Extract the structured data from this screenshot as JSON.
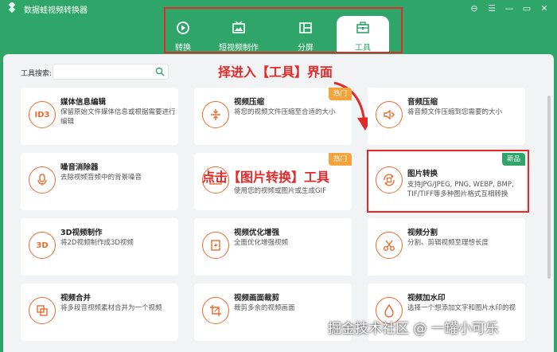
{
  "window": {
    "title": "数据蛙视频转换器",
    "controls": [
      "⊖",
      "☰",
      "—",
      "▭",
      "✕"
    ]
  },
  "tabs": [
    {
      "label": "转换",
      "icon": "convert-icon",
      "active": false
    },
    {
      "label": "短视频制作",
      "icon": "tv-icon",
      "active": false
    },
    {
      "label": "分屏",
      "icon": "split-screen-icon",
      "active": false
    },
    {
      "label": "工具",
      "icon": "toolbox-icon",
      "active": true
    }
  ],
  "search": {
    "label": "工具搜索:",
    "value": "",
    "placeholder": ""
  },
  "annotations": {
    "step1": "择进入【工具】界面",
    "step2": "点击【图片转换】工具"
  },
  "cards": [
    {
      "title": "媒体信息编辑",
      "desc": "保留原始文件媒体信息或根据需要进行编辑",
      "icon": "ID3",
      "badge": ""
    },
    {
      "title": "视频压缩",
      "desc": "将您的视频文件压缩至合适的大小",
      "icon": "compress-icon",
      "badge": "热门"
    },
    {
      "title": "音频压缩",
      "desc": "将音频文件压缩到您需要的大小",
      "icon": "audio-compress-icon",
      "badge": ""
    },
    {
      "title": "噪音消除器",
      "desc": "去除视频音频中的背景噪音",
      "icon": "noise-icon",
      "badge": ""
    },
    {
      "title": "",
      "desc": "使用您的视频或图片或生成GIF",
      "icon": "gif-icon",
      "badge": "热门"
    },
    {
      "title": "图片转换",
      "desc": "支持JPG/JPEG, PNG, WEBP, BMP, TIF/TIFF等多种图片格式互相转换",
      "icon": "image-convert-icon",
      "badge": "新品"
    },
    {
      "title": "3D视频制作",
      "desc": "将2D视频制作成3D视频",
      "icon": "3D",
      "badge": ""
    },
    {
      "title": "视频优化增强",
      "desc": "全面优化增强视频",
      "icon": "enhance-icon",
      "badge": ""
    },
    {
      "title": "视频分割",
      "desc": "分割、剪辑视频至理想长度",
      "icon": "scissors-icon",
      "badge": ""
    },
    {
      "title": "视频合并",
      "desc": "将多段音视频素材合并为一个视频",
      "icon": "merge-icon",
      "badge": ""
    },
    {
      "title": "视频画面裁剪",
      "desc": "裁剪多余的视频画面",
      "icon": "crop-icon",
      "badge": ""
    },
    {
      "title": "视频加水印",
      "desc": "选择一个想添加文字和图片水印的视",
      "icon": "watermark-icon",
      "badge": ""
    }
  ],
  "watermark": "掘金技术社区 @ 一罐小可乐",
  "colors": {
    "brand": "#2fa56a",
    "accent": "#ec6b2d",
    "annotation": "#e12a2a",
    "hot": "#f5a33a"
  }
}
